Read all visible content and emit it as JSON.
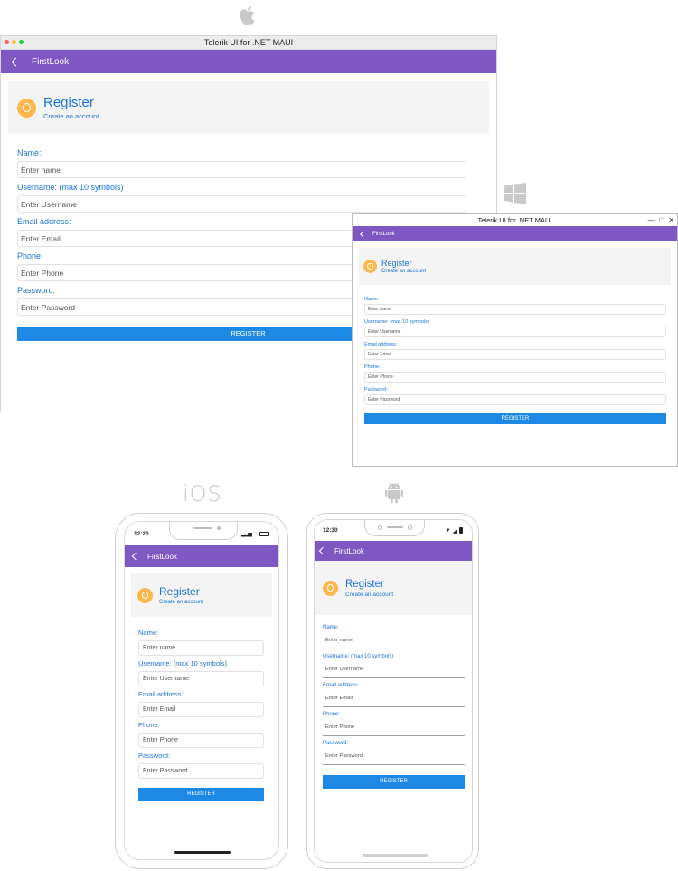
{
  "app": {
    "window_title": "Telerik UI for .NET MAUI",
    "nav_title": "FirstLook"
  },
  "form": {
    "title": "Register",
    "subtitle": "Create an account",
    "fields": [
      {
        "label": "Name:",
        "placeholder": "Enter name"
      },
      {
        "label": "Username: (max 10 symbols)",
        "placeholder": "Enter Username"
      },
      {
        "label": "Email address:",
        "placeholder": "Enter Email"
      },
      {
        "label": "Phone:",
        "placeholder": "Enter Phone"
      },
      {
        "label": "Password:",
        "placeholder": "Enter Password"
      }
    ],
    "submit_label": "REGISTER"
  },
  "platforms": {
    "ios_label": "iOS",
    "ios_time": "12:20",
    "android_time": "12:30"
  },
  "icons": {
    "back": "chevron-left-icon",
    "avatar": "user-avatar-icon",
    "apple": "apple-logo-icon",
    "windows": "windows-logo-icon",
    "android": "android-logo-icon",
    "minimize": "minimize-icon",
    "maximize": "maximize-icon",
    "close": "close-icon",
    "wifi": "wifi-icon",
    "signal": "signal-icon",
    "battery": "battery-icon"
  },
  "colors": {
    "navbar": "#7e57c2",
    "accent_text": "#1a73d9",
    "button": "#1e88e5",
    "avatar": "#ffb74d",
    "header_card": "#f4f4f4",
    "mac_close": "#ff5f57",
    "mac_minimize": "#febc2e",
    "mac_zoom": "#28c840"
  }
}
